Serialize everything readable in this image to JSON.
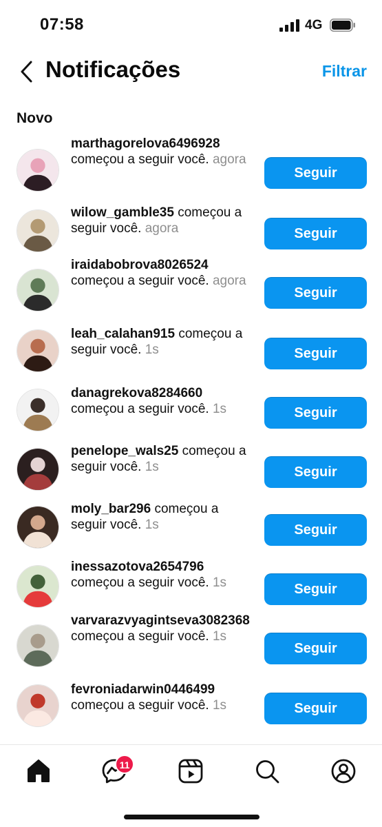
{
  "status_bar": {
    "time": "07:58",
    "network": "4G"
  },
  "header": {
    "title": "Notificações",
    "filter_label": "Filtrar"
  },
  "section_label": "Novo",
  "follow_label": "Seguir",
  "notifications": [
    {
      "username": "marthagorelova6496928",
      "action": "começou a seguir você.",
      "time": "agora"
    },
    {
      "username": "wilow_gamble35",
      "action": "começou a seguir você.",
      "time": "agora"
    },
    {
      "username": "iraidabobrova8026524",
      "action": "começou a seguir você.",
      "time": "agora"
    },
    {
      "username": "leah_calahan915",
      "action": "começou a seguir você.",
      "time": "1s"
    },
    {
      "username": "danagrekova8284660",
      "action": "começou a seguir você.",
      "time": "1s"
    },
    {
      "username": "penelope_wals25",
      "action": "começou a seguir você.",
      "time": "1s"
    },
    {
      "username": "moly_bar296",
      "action": "começou a seguir você.",
      "time": "1s"
    },
    {
      "username": "inessazotova2654796",
      "action": "começou a seguir você.",
      "time": "1s"
    },
    {
      "username": "varvarazvyagintseva3082368",
      "action": "começou a seguir você.",
      "time": "1s"
    },
    {
      "username": "fevroniadarwin0446499",
      "action": "começou a seguir você.",
      "time": "1s"
    }
  ],
  "tabbar": {
    "icons": [
      "home-icon",
      "messenger-icon",
      "reels-icon",
      "search-icon",
      "profile-icon"
    ],
    "messages_badge": "11"
  },
  "colors": {
    "accent": "#0a95f0",
    "badge": "#ed1a4a",
    "muted": "#8e8e8e"
  }
}
